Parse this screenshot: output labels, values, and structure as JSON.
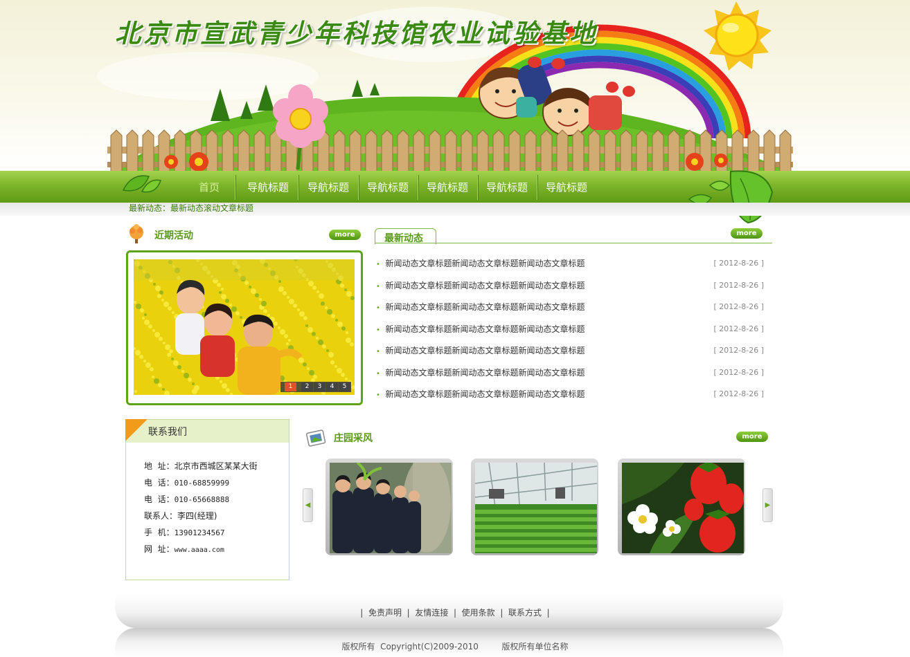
{
  "site": {
    "title": "北京市宣武青少年科技馆农业试验基地"
  },
  "nav": {
    "items": [
      {
        "label": "首页"
      },
      {
        "label": "导航标题"
      },
      {
        "label": "导航标题"
      },
      {
        "label": "导航标题"
      },
      {
        "label": "导航标题"
      },
      {
        "label": "导航标题"
      },
      {
        "label": "导航标题"
      }
    ]
  },
  "ticker": {
    "text": "最新动态：最新动态滚动文章标题"
  },
  "activities": {
    "title": "近期活动",
    "more": "more",
    "pager": [
      "1",
      "2",
      "3",
      "4",
      "5"
    ]
  },
  "news": {
    "title": "最新动态",
    "more": "more",
    "items": [
      {
        "title": "新闻动态文章标题新闻动态文章标题新闻动态文章标题",
        "date": "[ 2012-8-26 ]"
      },
      {
        "title": "新闻动态文章标题新闻动态文章标题新闻动态文章标题",
        "date": "[ 2012-8-26 ]"
      },
      {
        "title": "新闻动态文章标题新闻动态文章标题新闻动态文章标题",
        "date": "[ 2012-8-26 ]"
      },
      {
        "title": "新闻动态文章标题新闻动态文章标题新闻动态文章标题",
        "date": "[ 2012-8-26 ]"
      },
      {
        "title": "新闻动态文章标题新闻动态文章标题新闻动态文章标题",
        "date": "[ 2012-8-26 ]"
      },
      {
        "title": "新闻动态文章标题新闻动态文章标题新闻动态文章标题",
        "date": "[ 2012-8-26 ]"
      },
      {
        "title": "新闻动态文章标题新闻动态文章标题新闻动态文章标题",
        "date": "[ 2012-8-26 ]"
      }
    ]
  },
  "contact": {
    "title": "联系我们",
    "rows": [
      {
        "label": "地  址：",
        "value": "北京市西城区某某大街"
      },
      {
        "label": "电  话：",
        "value": "010-68859999"
      },
      {
        "label": "电  话：",
        "value": "010-65668888"
      },
      {
        "label": "联系人：",
        "value": "李四(经理)"
      },
      {
        "label": "手  机：",
        "value": "13901234567"
      },
      {
        "label": "网  址：",
        "value": "www.aaaa.com"
      }
    ]
  },
  "gallery": {
    "title": "庄园采风",
    "more": "more"
  },
  "footer": {
    "links": [
      "免责声明",
      "友情连接",
      "使用条款",
      "联系方式"
    ],
    "separator": "|",
    "copyright": "版权所有  Copyright(C)2009-2010",
    "owner": "版权所有单位名称"
  },
  "colors": {
    "accent": "#5f9a14",
    "title": "#3a8a12",
    "orange": "#f29a1a"
  }
}
